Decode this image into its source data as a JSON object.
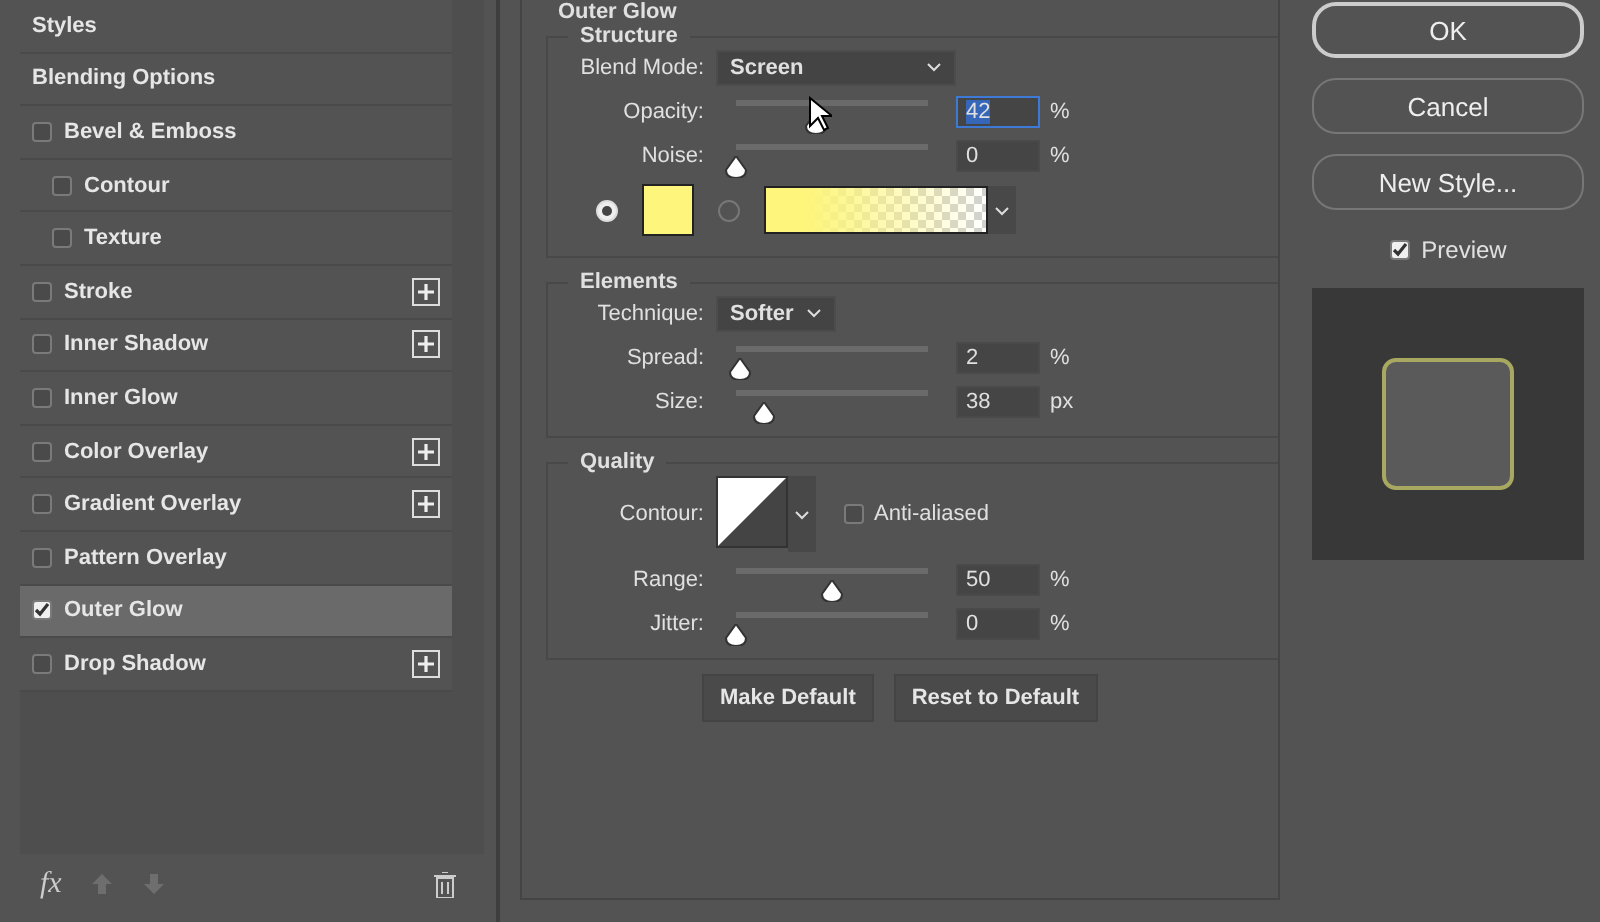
{
  "sidebar": {
    "items": [
      {
        "kind": "header",
        "label": "Styles",
        "selected": false
      },
      {
        "kind": "header",
        "label": "Blending Options",
        "selected": false
      },
      {
        "kind": "effect",
        "label": "Bevel & Emboss",
        "checked": false,
        "selected": false,
        "addable": false,
        "children": [
          {
            "kind": "effect",
            "label": "Contour",
            "checked": false,
            "selected": false,
            "addable": false
          },
          {
            "kind": "effect",
            "label": "Texture",
            "checked": false,
            "selected": false,
            "addable": false
          }
        ]
      },
      {
        "kind": "effect",
        "label": "Stroke",
        "checked": false,
        "selected": false,
        "addable": true
      },
      {
        "kind": "effect",
        "label": "Inner Shadow",
        "checked": false,
        "selected": false,
        "addable": true
      },
      {
        "kind": "effect",
        "label": "Inner Glow",
        "checked": false,
        "selected": false,
        "addable": false
      },
      {
        "kind": "effect",
        "label": "Color Overlay",
        "checked": false,
        "selected": false,
        "addable": true
      },
      {
        "kind": "effect",
        "label": "Gradient Overlay",
        "checked": false,
        "selected": false,
        "addable": true
      },
      {
        "kind": "effect",
        "label": "Pattern Overlay",
        "checked": false,
        "selected": false,
        "addable": false
      },
      {
        "kind": "effect",
        "label": "Outer Glow",
        "checked": true,
        "selected": true,
        "addable": false
      },
      {
        "kind": "effect",
        "label": "Drop Shadow",
        "checked": false,
        "selected": false,
        "addable": true
      }
    ],
    "footer": {
      "fx": "fx"
    }
  },
  "panel": {
    "title": "Outer Glow",
    "structure": {
      "title": "Structure",
      "blend_mode": {
        "label": "Blend Mode:",
        "value": "Screen"
      },
      "sliders": [
        {
          "label": "Opacity:",
          "level": 0.42,
          "value": "42",
          "unit": "%",
          "focused": true
        },
        {
          "label": "Noise:",
          "level": 0,
          "value": "0",
          "unit": "%",
          "focused": false
        }
      ],
      "color_mode": [
        {
          "kind": "solid",
          "selected": true,
          "color": "#fdf57c"
        },
        {
          "kind": "gradient",
          "selected": false,
          "color": "#fdf57c"
        }
      ]
    },
    "elements": {
      "title": "Elements",
      "technique": {
        "label": "Technique:",
        "value": "Softer"
      },
      "sliders": [
        {
          "label": "Spread:",
          "level": 0.02,
          "value": "2",
          "unit": "%",
          "focused": false
        },
        {
          "label": "Size:",
          "level": 0.15,
          "value": "38",
          "unit": "px",
          "focused": false
        }
      ]
    },
    "quality": {
      "title": "Quality",
      "contour_label": "Contour:",
      "anti_aliased": {
        "label": "Anti-aliased",
        "checked": false
      },
      "sliders": [
        {
          "label": "Range:",
          "level": 0.5,
          "value": "50",
          "unit": "%",
          "focused": false
        },
        {
          "label": "Jitter:",
          "level": 0,
          "value": "0",
          "unit": "%",
          "focused": false
        }
      ]
    },
    "buttons": [
      "Make Default",
      "Reset to Default"
    ]
  },
  "actions": {
    "buttons": [
      "OK",
      "Cancel",
      "New Style..."
    ],
    "preview": {
      "label": "Preview",
      "checked": true
    }
  }
}
